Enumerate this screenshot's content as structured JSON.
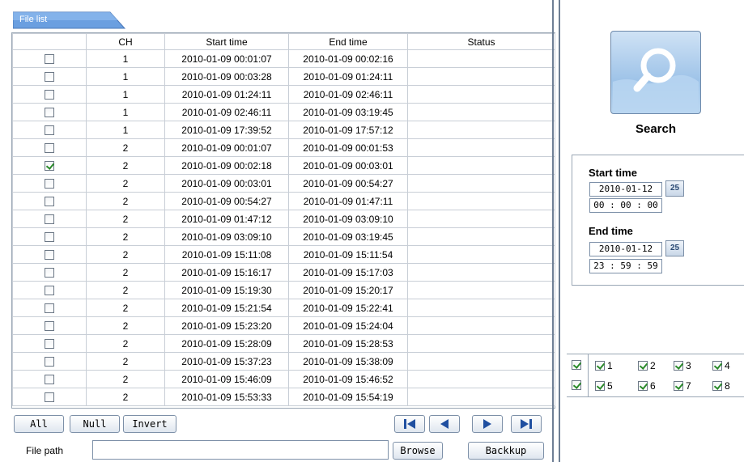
{
  "file_list": {
    "tab_label": "File list",
    "columns": [
      "",
      "CH",
      "Start time",
      "End time",
      "Status"
    ],
    "rows": [
      {
        "checked": false,
        "ch": "1",
        "start": "2010-01-09 00:01:07",
        "end": "2010-01-09 00:02:16",
        "status": ""
      },
      {
        "checked": false,
        "ch": "1",
        "start": "2010-01-09 00:03:28",
        "end": "2010-01-09 01:24:11",
        "status": ""
      },
      {
        "checked": false,
        "ch": "1",
        "start": "2010-01-09 01:24:11",
        "end": "2010-01-09 02:46:11",
        "status": ""
      },
      {
        "checked": false,
        "ch": "1",
        "start": "2010-01-09 02:46:11",
        "end": "2010-01-09 03:19:45",
        "status": ""
      },
      {
        "checked": false,
        "ch": "1",
        "start": "2010-01-09 17:39:52",
        "end": "2010-01-09 17:57:12",
        "status": ""
      },
      {
        "checked": false,
        "ch": "2",
        "start": "2010-01-09 00:01:07",
        "end": "2010-01-09 00:01:53",
        "status": ""
      },
      {
        "checked": true,
        "ch": "2",
        "start": "2010-01-09 00:02:18",
        "end": "2010-01-09 00:03:01",
        "status": ""
      },
      {
        "checked": false,
        "ch": "2",
        "start": "2010-01-09 00:03:01",
        "end": "2010-01-09 00:54:27",
        "status": ""
      },
      {
        "checked": false,
        "ch": "2",
        "start": "2010-01-09 00:54:27",
        "end": "2010-01-09 01:47:11",
        "status": ""
      },
      {
        "checked": false,
        "ch": "2",
        "start": "2010-01-09 01:47:12",
        "end": "2010-01-09 03:09:10",
        "status": ""
      },
      {
        "checked": false,
        "ch": "2",
        "start": "2010-01-09 03:09:10",
        "end": "2010-01-09 03:19:45",
        "status": ""
      },
      {
        "checked": false,
        "ch": "2",
        "start": "2010-01-09 15:11:08",
        "end": "2010-01-09 15:11:54",
        "status": ""
      },
      {
        "checked": false,
        "ch": "2",
        "start": "2010-01-09 15:16:17",
        "end": "2010-01-09 15:17:03",
        "status": ""
      },
      {
        "checked": false,
        "ch": "2",
        "start": "2010-01-09 15:19:30",
        "end": "2010-01-09 15:20:17",
        "status": ""
      },
      {
        "checked": false,
        "ch": "2",
        "start": "2010-01-09 15:21:54",
        "end": "2010-01-09 15:22:41",
        "status": ""
      },
      {
        "checked": false,
        "ch": "2",
        "start": "2010-01-09 15:23:20",
        "end": "2010-01-09 15:24:04",
        "status": ""
      },
      {
        "checked": false,
        "ch": "2",
        "start": "2010-01-09 15:28:09",
        "end": "2010-01-09 15:28:53",
        "status": ""
      },
      {
        "checked": false,
        "ch": "2",
        "start": "2010-01-09 15:37:23",
        "end": "2010-01-09 15:38:09",
        "status": ""
      },
      {
        "checked": false,
        "ch": "2",
        "start": "2010-01-09 15:46:09",
        "end": "2010-01-09 15:46:52",
        "status": ""
      },
      {
        "checked": false,
        "ch": "2",
        "start": "2010-01-09 15:53:33",
        "end": "2010-01-09 15:54:19",
        "status": ""
      }
    ]
  },
  "selection": {
    "all_label": "All",
    "null_label": "Null",
    "invert_label": "Invert"
  },
  "navigation": {
    "first_icon": "skip-first-icon",
    "prev_icon": "previous-icon",
    "next_icon": "next-icon",
    "last_icon": "skip-last-icon"
  },
  "file_path": {
    "label": "File path",
    "value": "",
    "browse_label": "Browse",
    "backup_label": "Backkup"
  },
  "search": {
    "label": "Search",
    "icon": "magnifier-icon"
  },
  "time_range": {
    "start_label": "Start time",
    "start_date": "2010-01-12",
    "start_time": "00 : 00 : 00",
    "end_label": "End time",
    "end_date": "2010-01-12",
    "end_time": "23 : 59 : 59",
    "calendar_label": "25"
  },
  "channels": [
    {
      "label": "1",
      "checked": true
    },
    {
      "label": "2",
      "checked": true
    },
    {
      "label": "3",
      "checked": true
    },
    {
      "label": "4",
      "checked": true
    },
    {
      "label": "5",
      "checked": true
    },
    {
      "label": "6",
      "checked": true
    },
    {
      "label": "7",
      "checked": true
    },
    {
      "label": "8",
      "checked": true
    }
  ],
  "channel_row_toggles": [
    true,
    true
  ],
  "colors": {
    "accent": "#6a9fe0",
    "border": "#7d90a8",
    "check": "#2a8a2a"
  }
}
